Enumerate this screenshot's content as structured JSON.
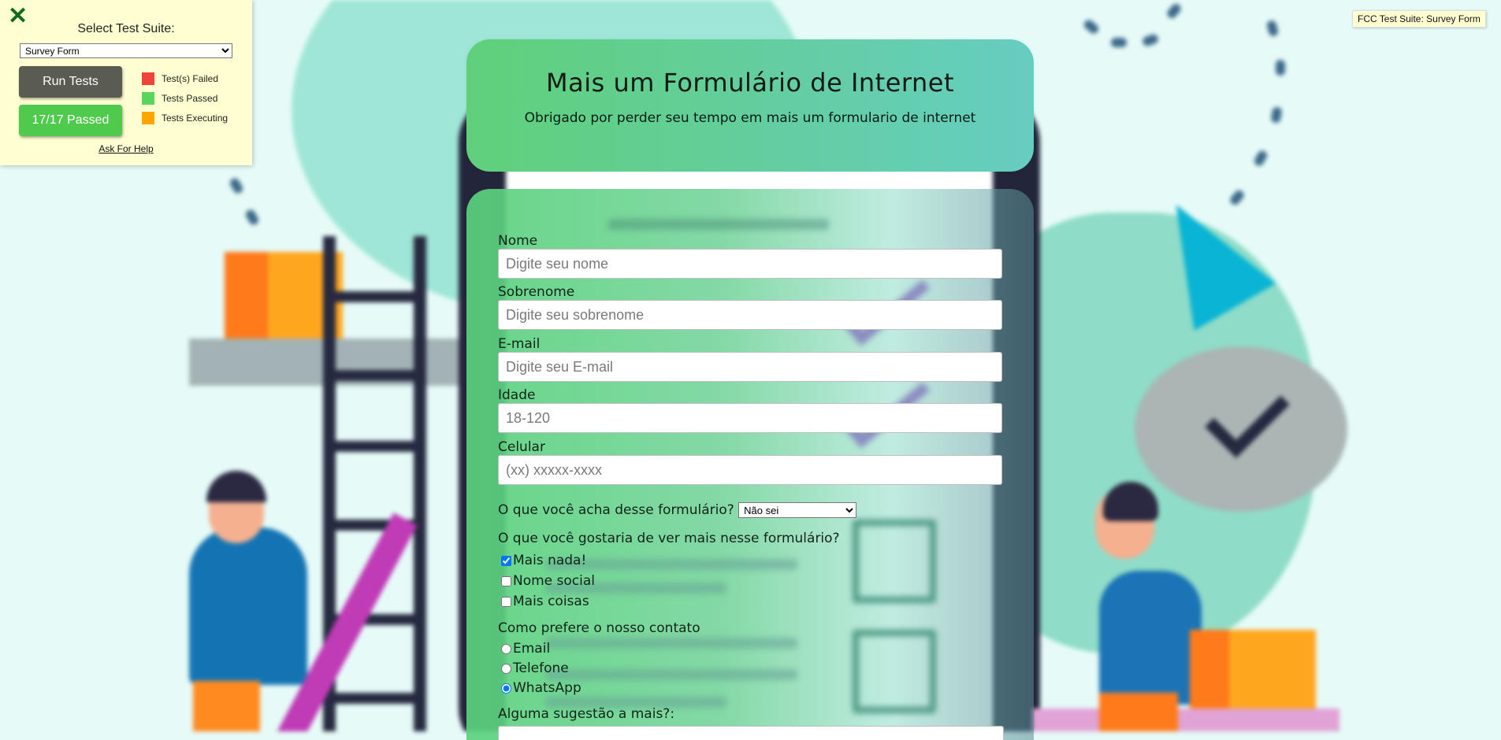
{
  "test_panel": {
    "title": "Select Test Suite:",
    "suite_selected": "Survey Form",
    "run_label": "Run Tests",
    "passed_label": "17/17 Passed",
    "legend": [
      {
        "label": "Test(s) Failed",
        "color": "#f0433a"
      },
      {
        "label": "Tests Passed",
        "color": "#5ad45a"
      },
      {
        "label": "Tests Executing",
        "color": "#ffa500"
      }
    ],
    "help_label": "Ask For Help"
  },
  "badge": "FCC Test Suite: Survey Form",
  "header": {
    "title": "Mais um Formulário de Internet",
    "description": "Obrigado por perder seu tempo em mais um formulario de internet"
  },
  "form": {
    "fields": [
      {
        "label": "Nome",
        "placeholder": "Digite seu nome"
      },
      {
        "label": "Sobrenome",
        "placeholder": "Digite seu sobrenome"
      },
      {
        "label": "E-mail",
        "placeholder": "Digite seu E-mail"
      },
      {
        "label": "Idade",
        "placeholder": "18-120"
      },
      {
        "label": "Celular",
        "placeholder": "(xx) xxxxx-xxxx"
      }
    ],
    "opinion_question": "O que você acha desse formulário?",
    "opinion_selected": "Não sei",
    "features_question": "O que você gostaria de ver mais nesse formulário?",
    "checkboxes": [
      {
        "label": "Mais nada!",
        "checked": true
      },
      {
        "label": "Nome social",
        "checked": false
      },
      {
        "label": "Mais coisas",
        "checked": false
      }
    ],
    "contact_question": "Como prefere o nosso contato",
    "radios": [
      {
        "label": "Email",
        "checked": false
      },
      {
        "label": "Telefone",
        "checked": false
      },
      {
        "label": "WhatsApp",
        "checked": true
      }
    ],
    "suggestion_label": "Alguma sugestão a mais?:"
  }
}
